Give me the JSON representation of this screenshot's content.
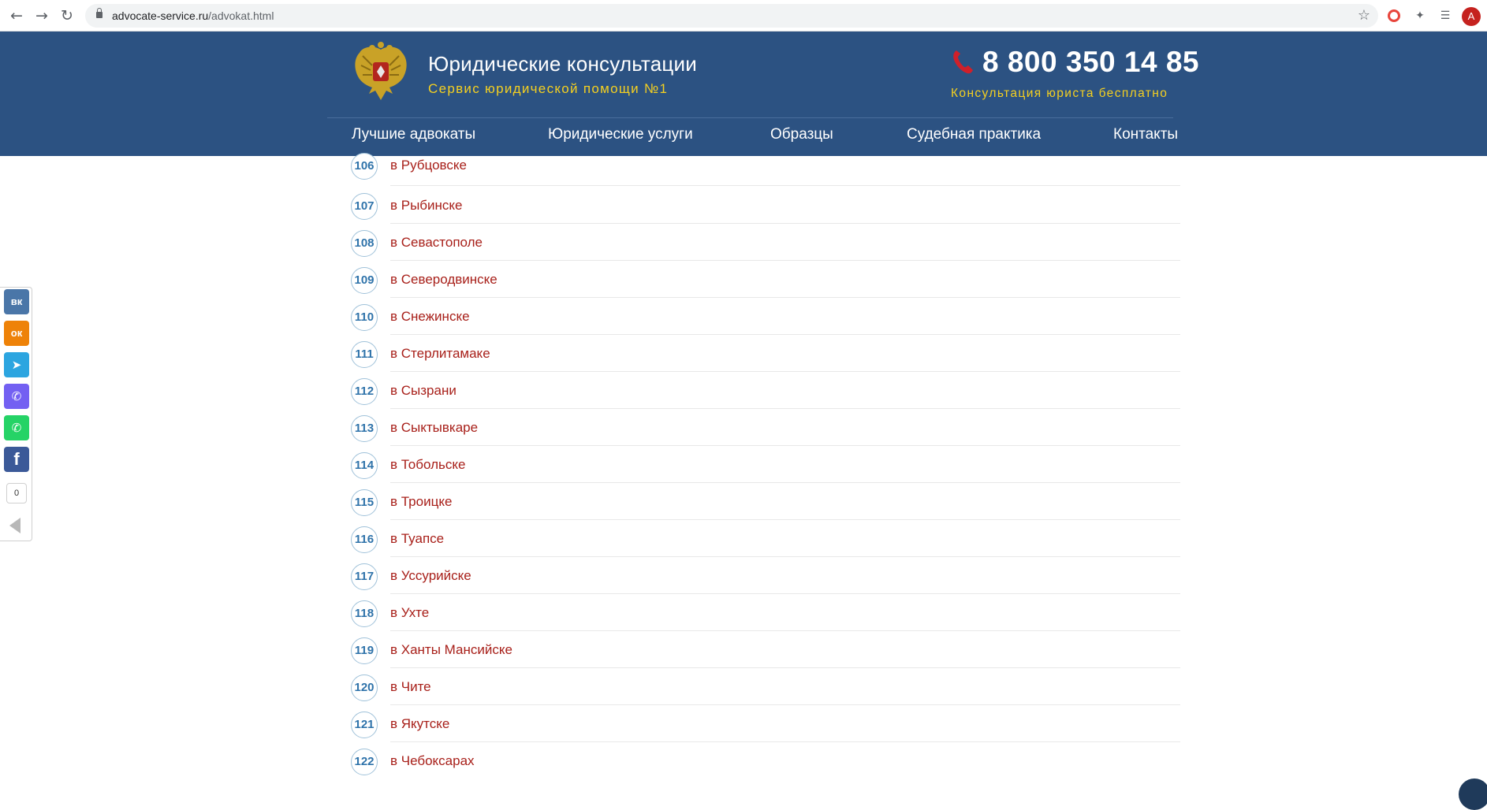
{
  "browser": {
    "url_host": "advocate-service.ru",
    "url_path": "/advokat.html",
    "avatar_letter": "A"
  },
  "header": {
    "title": "Юридические консультации",
    "subtitle": "Сервис юридической помощи №1",
    "phone": "8 800 350 14 85",
    "phone_caption": "Консультация юриста бесплатно",
    "colors": {
      "background": "#2c5282",
      "accent": "#f5d020",
      "phone_icon": "#d0202a"
    }
  },
  "menu": [
    {
      "label": "Лучшие адвокаты"
    },
    {
      "label": "Юридические услуги"
    },
    {
      "label": "Образцы"
    },
    {
      "label": "Судебная практика"
    },
    {
      "label": "Контакты"
    }
  ],
  "cities": [
    {
      "num": "106",
      "label": "в Рубцовске"
    },
    {
      "num": "107",
      "label": "в Рыбинске"
    },
    {
      "num": "108",
      "label": "в Севастополе"
    },
    {
      "num": "109",
      "label": "в Северодвинске"
    },
    {
      "num": "110",
      "label": "в Снежинске"
    },
    {
      "num": "111",
      "label": "в Стерлитамаке"
    },
    {
      "num": "112",
      "label": "в Сызрани"
    },
    {
      "num": "113",
      "label": "в Сыктывкаре"
    },
    {
      "num": "114",
      "label": "в Тобольске"
    },
    {
      "num": "115",
      "label": "в Троицке"
    },
    {
      "num": "116",
      "label": "в Туапсе"
    },
    {
      "num": "117",
      "label": "в Уссурийске"
    },
    {
      "num": "118",
      "label": "в Ухте"
    },
    {
      "num": "119",
      "label": "в Ханты Мансийске"
    },
    {
      "num": "120",
      "label": "в Чите"
    },
    {
      "num": "121",
      "label": "в Якутске"
    },
    {
      "num": "122",
      "label": "в Чебоксарах"
    }
  ],
  "share": {
    "count": "0",
    "buttons": [
      {
        "name": "vk",
        "glyph": "вк",
        "color": "#4a76a8"
      },
      {
        "name": "odnoklassniki",
        "glyph": "ок",
        "color": "#ee8208"
      },
      {
        "name": "telegram",
        "glyph": "➤",
        "color": "#2ca5e0"
      },
      {
        "name": "viber",
        "glyph": "✆",
        "color": "#7360f2"
      },
      {
        "name": "whatsapp",
        "glyph": "✆",
        "color": "#25d366"
      },
      {
        "name": "facebook",
        "glyph": "f",
        "color": "#3b5998"
      }
    ]
  }
}
